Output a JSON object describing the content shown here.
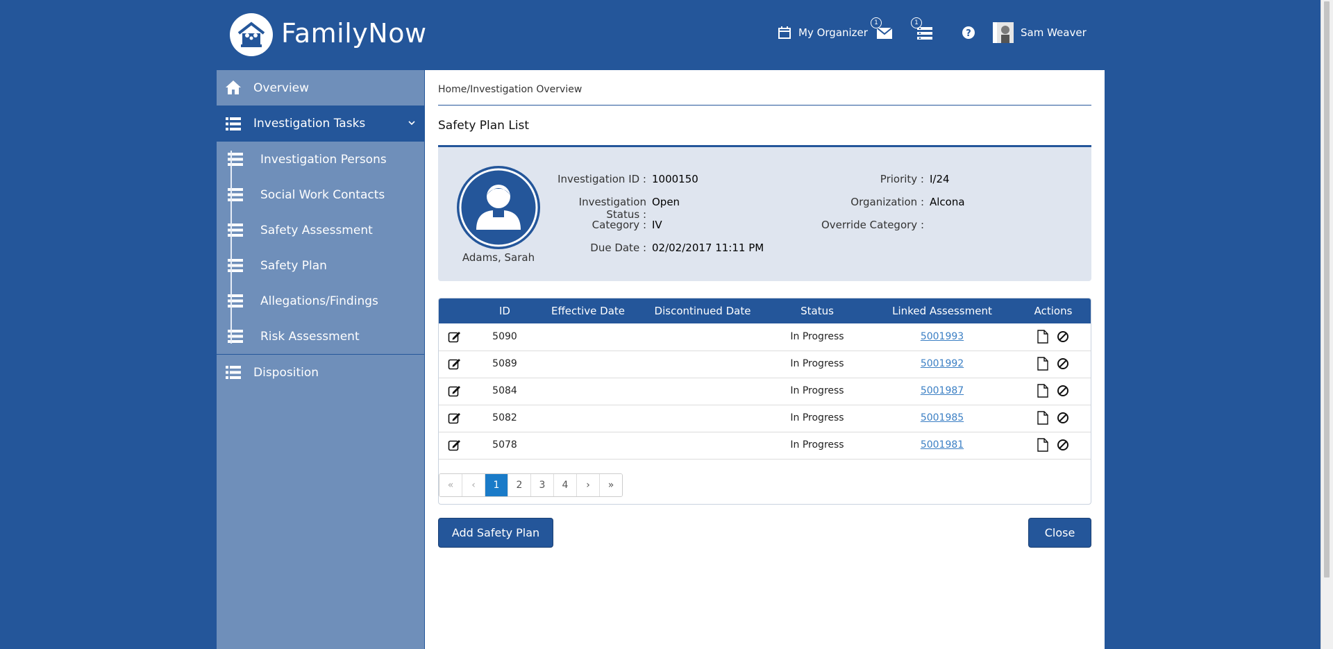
{
  "app": {
    "title": "FamilyNow"
  },
  "header": {
    "organizer_label": "My Organizer",
    "mail_count": "1",
    "queue_count": "1",
    "user_name": "Sam Weaver"
  },
  "sidebar": {
    "overview": "Overview",
    "tasks": "Investigation Tasks",
    "sub_items": [
      {
        "label": "Investigation Persons"
      },
      {
        "label": "Social Work Contacts"
      },
      {
        "label": "Safety Assessment"
      },
      {
        "label": "Safety Plan"
      },
      {
        "label": "Allegations/Findings"
      },
      {
        "label": "Risk Assessment"
      }
    ],
    "disposition": "Disposition"
  },
  "breadcrumb": {
    "home": "Home",
    "sep": "/",
    "current": "Investigation Overview"
  },
  "page_title": "Safety Plan List",
  "person": {
    "name": "Adams, Sarah"
  },
  "investigation": {
    "id_label": "Investigation ID :",
    "id": "1000150",
    "status_label": "Investigation Status :",
    "status": "Open",
    "category_label": "Category :",
    "category": "IV",
    "due_label": "Due Date :",
    "due": "02/02/2017 11:11 PM",
    "priority_label": "Priority :",
    "priority": "I/24",
    "org_label": "Organization :",
    "org": "Alcona",
    "override_label": "Override Category :",
    "override": ""
  },
  "table": {
    "headers": [
      "ID",
      "Effective Date",
      "Discontinued Date",
      "Status",
      "Linked Assessment",
      "Actions"
    ],
    "rows": [
      {
        "id": "5090",
        "effective": "",
        "discontinued": "",
        "status": "In Progress",
        "linked": "5001993"
      },
      {
        "id": "5089",
        "effective": "",
        "discontinued": "",
        "status": "In Progress",
        "linked": "5001992"
      },
      {
        "id": "5084",
        "effective": "",
        "discontinued": "",
        "status": "In Progress",
        "linked": "5001987"
      },
      {
        "id": "5082",
        "effective": "",
        "discontinued": "",
        "status": "In Progress",
        "linked": "5001985"
      },
      {
        "id": "5078",
        "effective": "",
        "discontinued": "",
        "status": "In Progress",
        "linked": "5001981"
      }
    ]
  },
  "pager": {
    "first": "«",
    "prev": "‹",
    "pages": [
      "1",
      "2",
      "3",
      "4"
    ],
    "next": "›",
    "last": "»",
    "current": "1"
  },
  "buttons": {
    "add": "Add Safety Plan",
    "close": "Close"
  },
  "colors": {
    "primary": "#24569a",
    "sidebar": "#6f8fba",
    "panel": "#dfe5ef",
    "link": "#3b7fc4",
    "active_page": "#1a7bc8"
  }
}
